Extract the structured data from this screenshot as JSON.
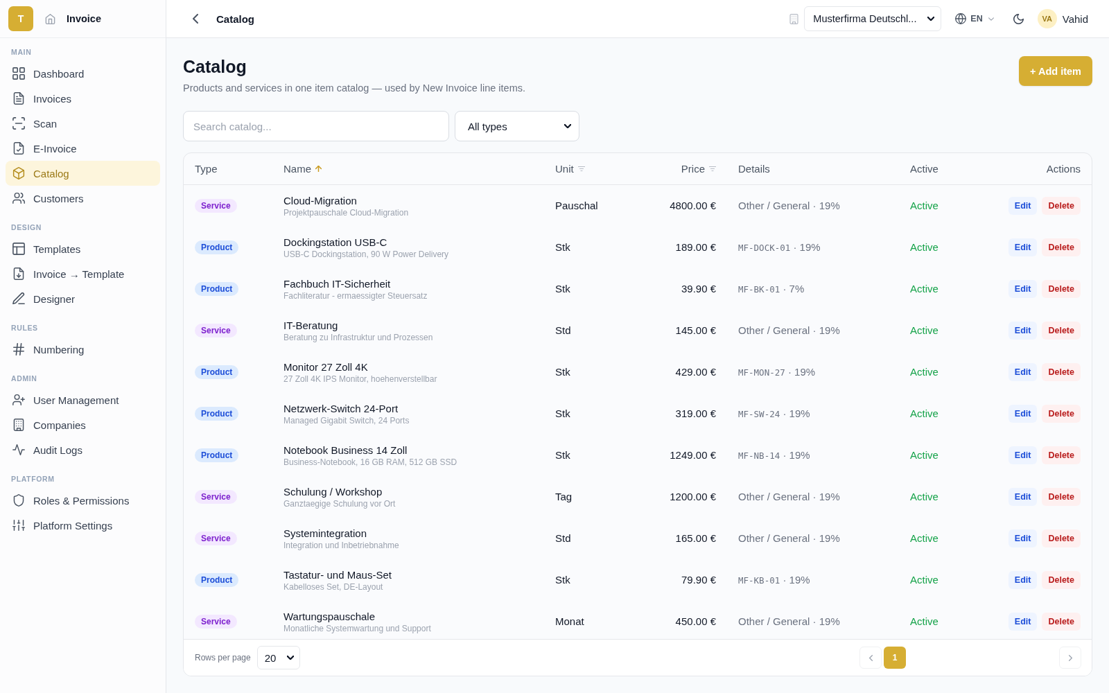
{
  "sidebar": {
    "logo": "T",
    "brand": "Invoice",
    "sections": [
      {
        "label": "MAIN",
        "items": [
          {
            "label": "Dashboard",
            "selected": false
          },
          {
            "label": "Invoices",
            "selected": false
          },
          {
            "label": "Scan",
            "selected": false
          },
          {
            "label": "E-Invoice",
            "selected": false
          },
          {
            "label": "Catalog",
            "selected": true
          },
          {
            "label": "Customers",
            "selected": false
          }
        ]
      },
      {
        "label": "DESIGN",
        "items": [
          {
            "label": "Templates",
            "selected": false
          },
          {
            "label": "Invoice → Template",
            "selected": false
          },
          {
            "label": "Designer",
            "selected": false
          }
        ]
      },
      {
        "label": "RULES",
        "items": [
          {
            "label": "Numbering",
            "selected": false
          }
        ]
      },
      {
        "label": "ADMIN",
        "items": [
          {
            "label": "User Management",
            "selected": false
          },
          {
            "label": "Companies",
            "selected": false
          },
          {
            "label": "Audit Logs",
            "selected": false
          }
        ]
      },
      {
        "label": "PLATFORM",
        "items": [
          {
            "label": "Roles & Permissions",
            "selected": false
          },
          {
            "label": "Platform Settings",
            "selected": false
          }
        ]
      }
    ]
  },
  "topbar": {
    "title": "Catalog",
    "company": "Musterfirma Deutschl...",
    "language": "EN",
    "user": {
      "initials": "VA",
      "name": "Vahid"
    }
  },
  "page": {
    "title": "Catalog",
    "subtitle": "Products and services in one item catalog — used by New Invoice line items.",
    "add_button": "+ Add item"
  },
  "filters": {
    "search": {
      "placeholder": "Search catalog..."
    },
    "type": "All types"
  },
  "table": {
    "columns": [
      {
        "label": "Type",
        "sortable": false
      },
      {
        "label": "Name",
        "sortable": true,
        "sorted": true
      },
      {
        "label": "Unit",
        "sortable": true,
        "sorted": false
      },
      {
        "label": "Price",
        "sortable": true,
        "sorted": false
      },
      {
        "label": "Details",
        "sortable": false
      },
      {
        "label": "Active",
        "sortable": false
      },
      {
        "label": "Actions",
        "sortable": false
      }
    ],
    "rows": [
      {
        "type": "Service",
        "kind": "service",
        "name": "Cloud-Migration",
        "description": "Projektpauschale Cloud-Migration",
        "unit": "Pauschal",
        "price": "4800.00 €",
        "details": {
          "kind": "category",
          "text": "Other / General",
          "tax": "· 19%"
        },
        "status": "Active",
        "active": true,
        "edit": "Edit",
        "delete": "Delete"
      },
      {
        "type": "Product",
        "kind": "product",
        "name": "Dockingstation USB-C",
        "description": "USB-C Dockingstation, 90 W Power Delivery",
        "unit": "Stk",
        "price": "189.00 €",
        "details": {
          "kind": "sku",
          "text": "MF-DOCK-01",
          "tax": "· 19%"
        },
        "status": "Active",
        "active": true,
        "edit": "Edit",
        "delete": "Delete"
      },
      {
        "type": "Product",
        "kind": "product",
        "name": "Fachbuch IT-Sicherheit",
        "description": "Fachliteratur - ermaessigter Steuersatz",
        "unit": "Stk",
        "price": "39.90 €",
        "details": {
          "kind": "sku",
          "text": "MF-BK-01",
          "tax": "· 7%"
        },
        "status": "Active",
        "active": true,
        "edit": "Edit",
        "delete": "Delete"
      },
      {
        "type": "Service",
        "kind": "service",
        "name": "IT-Beratung",
        "description": "Beratung zu Infrastruktur und Prozessen",
        "unit": "Std",
        "price": "145.00 €",
        "details": {
          "kind": "category",
          "text": "Other / General",
          "tax": "· 19%"
        },
        "status": "Active",
        "active": true,
        "edit": "Edit",
        "delete": "Delete"
      },
      {
        "type": "Product",
        "kind": "product",
        "name": "Monitor 27 Zoll 4K",
        "description": "27 Zoll 4K IPS Monitor, hoehenverstellbar",
        "unit": "Stk",
        "price": "429.00 €",
        "details": {
          "kind": "sku",
          "text": "MF-MON-27",
          "tax": "· 19%"
        },
        "status": "Active",
        "active": true,
        "edit": "Edit",
        "delete": "Delete"
      },
      {
        "type": "Product",
        "kind": "product",
        "name": "Netzwerk-Switch 24-Port",
        "description": "Managed Gigabit Switch, 24 Ports",
        "unit": "Stk",
        "price": "319.00 €",
        "details": {
          "kind": "sku",
          "text": "MF-SW-24",
          "tax": "· 19%"
        },
        "status": "Active",
        "active": true,
        "edit": "Edit",
        "delete": "Delete"
      },
      {
        "type": "Product",
        "kind": "product",
        "name": "Notebook Business 14 Zoll",
        "description": "Business-Notebook, 16 GB RAM, 512 GB SSD",
        "unit": "Stk",
        "price": "1249.00 €",
        "details": {
          "kind": "sku",
          "text": "MF-NB-14",
          "tax": "· 19%"
        },
        "status": "Active",
        "active": true,
        "edit": "Edit",
        "delete": "Delete"
      },
      {
        "type": "Service",
        "kind": "service",
        "name": "Schulung / Workshop",
        "description": "Ganztaegige Schulung vor Ort",
        "unit": "Tag",
        "price": "1200.00 €",
        "details": {
          "kind": "category",
          "text": "Other / General",
          "tax": "· 19%"
        },
        "status": "Active",
        "active": true,
        "edit": "Edit",
        "delete": "Delete"
      },
      {
        "type": "Service",
        "kind": "service",
        "name": "Systemintegration",
        "description": "Integration und Inbetriebnahme",
        "unit": "Std",
        "price": "165.00 €",
        "details": {
          "kind": "category",
          "text": "Other / General",
          "tax": "· 19%"
        },
        "status": "Active",
        "active": true,
        "edit": "Edit",
        "delete": "Delete"
      },
      {
        "type": "Product",
        "kind": "product",
        "name": "Tastatur- und Maus-Set",
        "description": "Kabelloses Set, DE-Layout",
        "unit": "Stk",
        "price": "79.90 €",
        "details": {
          "kind": "sku",
          "text": "MF-KB-01",
          "tax": "· 19%"
        },
        "status": "Active",
        "active": true,
        "edit": "Edit",
        "delete": "Delete"
      },
      {
        "type": "Service",
        "kind": "service",
        "name": "Wartungspauschale",
        "description": "Monatliche Systemwartung und Support",
        "unit": "Monat",
        "price": "450.00 €",
        "details": {
          "kind": "category",
          "text": "Other / General",
          "tax": "· 19%"
        },
        "status": "Active",
        "active": true,
        "edit": "Edit",
        "delete": "Delete"
      }
    ],
    "rows_per_page_label": "Rows per page",
    "rows_per_page": "20",
    "pages": [
      {
        "label": "1",
        "selected": true
      }
    ]
  }
}
